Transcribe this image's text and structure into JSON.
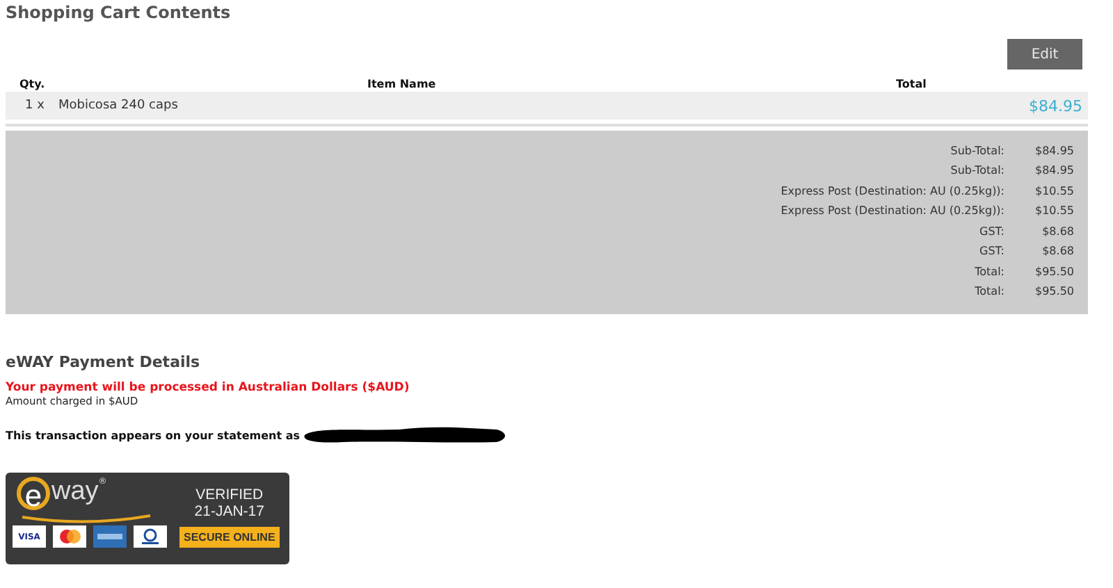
{
  "cart": {
    "title": "Shopping Cart Contents",
    "edit_button": "Edit",
    "columns": [
      "Qty.",
      "Item Name",
      "Total"
    ],
    "rows": [
      {
        "qty": "1 x",
        "name": "Mobicosa 240 caps",
        "total": "$84.95"
      }
    ],
    "totals": [
      {
        "label": "Sub-Total:",
        "value": "$84.95"
      },
      {
        "label": "Sub-Total:",
        "value": "$84.95"
      },
      {
        "label": "Express Post (Destination: AU (0.25kg)):",
        "value": "$10.55"
      },
      {
        "label": "Express Post (Destination: AU (0.25kg)):",
        "value": "$10.55"
      },
      {
        "label": "GST:",
        "value": "$8.68"
      },
      {
        "label": "GST:",
        "value": "$8.68"
      },
      {
        "label": "Total:",
        "value": "$95.50"
      },
      {
        "label": "Total:",
        "value": "$95.50"
      }
    ]
  },
  "payment": {
    "title": "eWAY Payment Details",
    "currency_notice": "Your payment will be processed in Australian Dollars ($AUD)",
    "amount_note": "Amount charged in $AUD",
    "statement": "This transaction appears on your statement as"
  },
  "badge": {
    "logo": "e",
    "logo_rest": "way",
    "registered": "®",
    "status": "VERIFIED",
    "date": "21-JAN-17",
    "card": "VISA",
    "secure": "SECURE ONLINE"
  }
}
